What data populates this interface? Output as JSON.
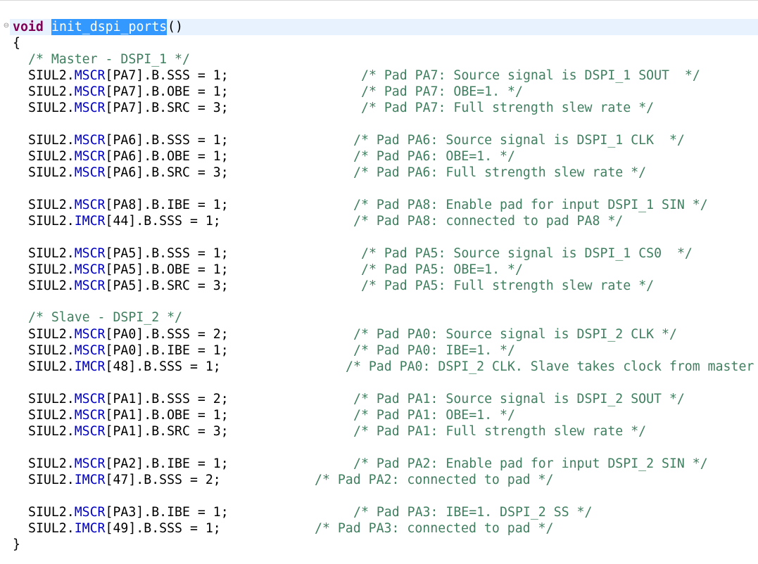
{
  "editor": {
    "fold_marker": "⊖",
    "signature": {
      "keyword": "void",
      "name": "init_dspi_ports",
      "parens": "()"
    },
    "open_brace": "{",
    "close_brace": "}",
    "master_comment": "/* Master - DSPI_1 */",
    "slave_comment": "/* Slave - DSPI_2 */",
    "statements": [
      {
        "p1": "SIUL2.",
        "reg": "MSCR",
        "p2": "[PA7].B.SSS = 1;",
        "comment": "/* Pad PA7: Source signal is DSPI_1 SOUT  */"
      },
      {
        "p1": "SIUL2.",
        "reg": "MSCR",
        "p2": "[PA7].B.OBE = 1;",
        "comment": "/* Pad PA7: OBE=1. */"
      },
      {
        "p1": "SIUL2.",
        "reg": "MSCR",
        "p2": "[PA7].B.SRC = 3;",
        "comment": "/* Pad PA7: Full strength slew rate */"
      },
      {
        "p1": "SIUL2.",
        "reg": "MSCR",
        "p2": "[PA6].B.SSS = 1;",
        "comment": "/* Pad PA6: Source signal is DSPI_1 CLK  */"
      },
      {
        "p1": "SIUL2.",
        "reg": "MSCR",
        "p2": "[PA6].B.OBE = 1;",
        "comment": "/* Pad PA6: OBE=1. */"
      },
      {
        "p1": "SIUL2.",
        "reg": "MSCR",
        "p2": "[PA6].B.SRC = 3;",
        "comment": "/* Pad PA6: Full strength slew rate */"
      },
      {
        "p1": "SIUL2.",
        "reg": "MSCR",
        "p2": "[PA8].B.IBE = 1;",
        "comment": "/* Pad PA8: Enable pad for input DSPI_1 SIN */"
      },
      {
        "p1": "SIUL2.",
        "reg": "IMCR",
        "p2": "[44].B.SSS = 1;",
        "comment": "/* Pad PA8: connected to pad PA8 */"
      },
      {
        "p1": "SIUL2.",
        "reg": "MSCR",
        "p2": "[PA5].B.SSS = 1;",
        "comment": "/* Pad PA5: Source signal is DSPI_1 CS0  */"
      },
      {
        "p1": "SIUL2.",
        "reg": "MSCR",
        "p2": "[PA5].B.OBE = 1;",
        "comment": "/* Pad PA5: OBE=1. */"
      },
      {
        "p1": "SIUL2.",
        "reg": "MSCR",
        "p2": "[PA5].B.SRC = 3;",
        "comment": "/* Pad PA5: Full strength slew rate */"
      },
      {
        "p1": "SIUL2.",
        "reg": "MSCR",
        "p2": "[PA0].B.SSS = 2;",
        "comment": "/* Pad PA0: Source signal is DSPI_2 CLK */"
      },
      {
        "p1": "SIUL2.",
        "reg": "MSCR",
        "p2": "[PA0].B.IBE = 1;",
        "comment": "/* Pad PA0: IBE=1. */"
      },
      {
        "p1": "SIUL2.",
        "reg": "IMCR",
        "p2": "[48].B.SSS = 1;",
        "comment": "/* Pad PA0: DSPI_2 CLK. Slave takes clock from master"
      },
      {
        "p1": "SIUL2.",
        "reg": "MSCR",
        "p2": "[PA1].B.SSS = 2;",
        "comment": "/* Pad PA1: Source signal is DSPI_2 SOUT */"
      },
      {
        "p1": "SIUL2.",
        "reg": "MSCR",
        "p2": "[PA1].B.OBE = 1;",
        "comment": "/* Pad PA1: OBE=1. */"
      },
      {
        "p1": "SIUL2.",
        "reg": "MSCR",
        "p2": "[PA1].B.SRC = 3;",
        "comment": "/* Pad PA1: Full strength slew rate */"
      },
      {
        "p1": "SIUL2.",
        "reg": "MSCR",
        "p2": "[PA2].B.IBE = 1;",
        "comment": "/* Pad PA2: Enable pad for input DSPI_2 SIN */"
      },
      {
        "p1": "SIUL2.",
        "reg": "IMCR",
        "p2": "[47].B.SSS = 2;",
        "comment": "/* Pad PA2: connected to pad */"
      },
      {
        "p1": "SIUL2.",
        "reg": "MSCR",
        "p2": "[PA3].B.IBE = 1;",
        "comment": "/* Pad PA3: IBE=1. DSPI_2 SS */"
      },
      {
        "p1": "SIUL2.",
        "reg": "IMCR",
        "p2": "[49].B.SSS = 1;",
        "comment": "/* Pad PA3: connected to pad */"
      }
    ],
    "colors": {
      "keyword": "#7f0055",
      "comment": "#3f7f5f",
      "field": "#0000c0",
      "selection": "#3399ff",
      "current_line": "#e8f2fe"
    }
  }
}
